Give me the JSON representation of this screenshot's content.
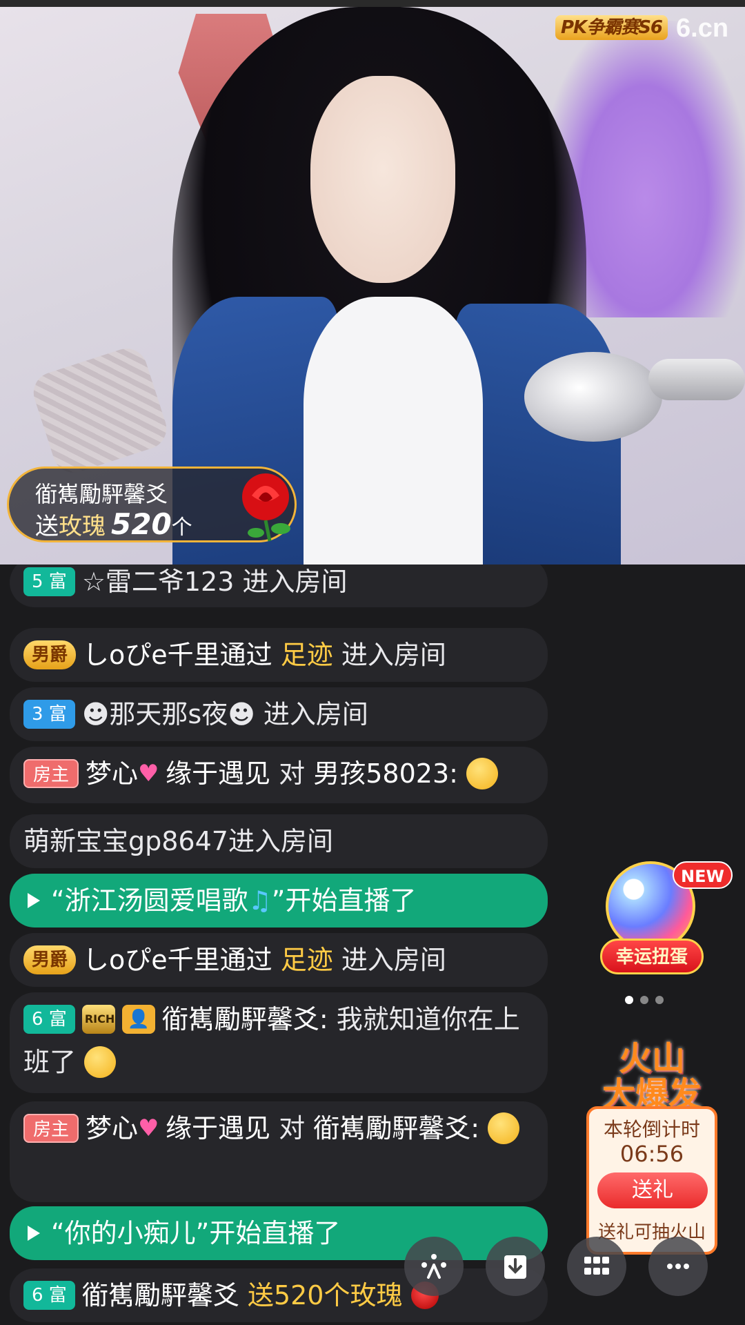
{
  "video": {
    "logo_text": "PK争霸赛S6",
    "site_logo": "6.cn",
    "gift_banner": {
      "sender": "衜嶲勵駍馨爻",
      "verb": "送",
      "gift_name": "玫瑰",
      "count": "520",
      "unit": "个",
      "icon": "rose-icon"
    }
  },
  "chat": [
    {
      "badge": "5 富",
      "text": "☆雷二爷123 进入房间"
    },
    {
      "badge": "男爵",
      "nick": "しoぴe千里通过",
      "highlight": "足迹",
      "rest": "进入房间"
    },
    {
      "badge": "3 富",
      "text": "☻那天那s夜☻ 进入房间"
    },
    {
      "badge": "房主",
      "nick_a": "梦心",
      "nick_b": "缘于遇见",
      "mid": "对",
      "target": "男孩58023:"
    },
    {
      "text": "萌新宝宝gp8647进入房间"
    },
    {
      "text_a": "“浙江汤圆爱唱歌",
      "text_b": "”开始直播了"
    },
    {
      "badge": "男爵",
      "nick": "しoぴe千里通过",
      "highlight": "足迹",
      "rest": "进入房间"
    },
    {
      "badge": "6 富",
      "badge_rich": "RICH",
      "nick": "衜嶲勵駍馨爻:",
      "text": "我就知道你在上班了"
    },
    {
      "badge": "房主",
      "nick_a": "梦心",
      "nick_b": "缘于遇见",
      "mid": "对",
      "target": "衜嶲勵駍馨爻:"
    },
    {
      "text": "“你的小痴儿”开始直播了"
    },
    {
      "badge": "6 富",
      "nick": "衜嶲勵駍馨爻",
      "highlight": "送520个玫瑰"
    }
  ],
  "widgets": {
    "lucky": {
      "new_label": "NEW",
      "label": "幸运扭蛋"
    },
    "volcano": {
      "title_line1": "火山",
      "title_line2": "大爆发",
      "countdown_label": "本轮倒计时",
      "countdown": "06:56",
      "send_label": "送礼",
      "note": "送礼可抽火山"
    }
  },
  "toolbar": {
    "buttons": [
      "share-icon",
      "download-icon",
      "apps-icon",
      "more-icon"
    ]
  },
  "colors": {
    "accent_green": "#12a87a",
    "gold_text": "#ffcb45",
    "chat_bg": "#26262a",
    "host_badge": "#ef6c6c",
    "rich_badge": "#12b89a"
  }
}
